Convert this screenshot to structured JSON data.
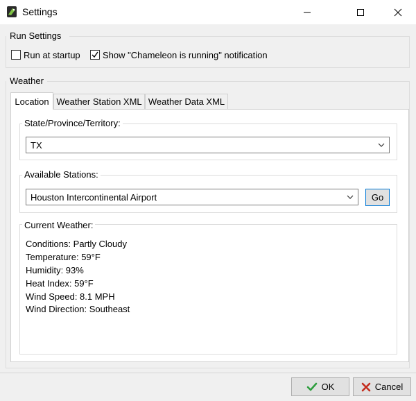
{
  "window": {
    "title": "Settings",
    "icon": "chameleon-app-icon"
  },
  "run_settings": {
    "title": "Run Settings",
    "run_at_startup": {
      "label": "Run at startup",
      "checked": false
    },
    "show_notification": {
      "label": "Show \"Chameleon is running\" notification",
      "checked": true
    }
  },
  "weather": {
    "title": "Weather",
    "tabs": [
      {
        "label": "Location",
        "active": true
      },
      {
        "label": "Weather Station XML",
        "active": false
      },
      {
        "label": "Weather Data XML",
        "active": false
      }
    ],
    "state": {
      "legend": "State/Province/Territory:",
      "value": "TX"
    },
    "stations": {
      "legend": "Available Stations:",
      "value": "Houston Intercontinental Airport",
      "go_label": "Go"
    },
    "current": {
      "legend": "Current Weather:",
      "lines": [
        "Conditions: Partly Cloudy",
        "Temperature: 59°F",
        "Humidity: 93%",
        "Heat Index: 59°F",
        "Wind Speed: 8.1 MPH",
        "Wind Direction: Southeast"
      ]
    }
  },
  "footer": {
    "ok_label": "OK",
    "cancel_label": "Cancel"
  },
  "colors": {
    "accent": "#0078d7",
    "ok_check": "#2e9e3e",
    "cancel_x": "#c42b1c"
  }
}
